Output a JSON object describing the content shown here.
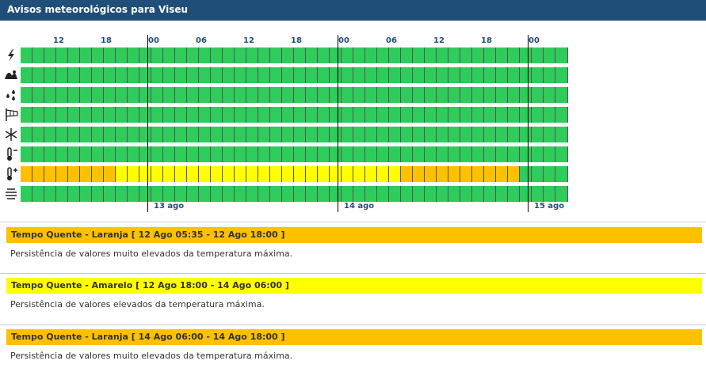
{
  "header": {
    "title": "Avisos meteorológicos para Viseu"
  },
  "timeline": {
    "hour_labels": [
      "12",
      "18",
      "00",
      "06",
      "12",
      "18",
      "00",
      "06",
      "12",
      "18",
      "00"
    ],
    "day_labels": [
      "13 ago",
      "14 ago",
      "15 ago"
    ],
    "slots_per_row": 46,
    "rows": [
      {
        "name": "lightning-icon",
        "levels": "gggggggggggggggggggggggggggggggggggggggggggggg"
      },
      {
        "name": "waves-icon",
        "levels": "gggggggggggggggggggggggggggggggggggggggggggggg"
      },
      {
        "name": "rain-icon",
        "levels": "gggggggggggggggggggggggggggggggggggggggggggggg"
      },
      {
        "name": "wind-flag-icon",
        "levels": "gggggggggggggggggggggggggggggggggggggggggggggg"
      },
      {
        "name": "snowflake-icon",
        "levels": "gggggggggggggggggggggggggggggggggggggggggggggg"
      },
      {
        "name": "thermometer-cold-icon",
        "levels": "gggggggggggggggggggggggggggggggggggggggggggggg"
      },
      {
        "name": "thermometer-hot-icon",
        "levels": "ooooooooyyyyyyyyyyyyyyyyyyyyyyyyoooooooooogggggg"
      },
      {
        "name": "fog-icon",
        "levels": "gggggggggggggggggggggggggggggggggggggggggggggg"
      }
    ]
  },
  "colors": {
    "green": "#2ecc5a",
    "yellow": "#ffff00",
    "orange": "#ffc000",
    "header": "#1f4e79"
  },
  "warnings": [
    {
      "title": "Tempo Quente - Laranja [ 12 Ago 05:35 - 12 Ago 18:00 ]",
      "description": "Persistência de valores muito elevados da temperatura máxima.",
      "level": "orange"
    },
    {
      "title": "Tempo Quente - Amarelo [ 12 Ago 18:00 - 14 Ago 06:00 ]",
      "description": "Persistência de valores elevados da temperatura máxima.",
      "level": "yellow"
    },
    {
      "title": "Tempo Quente - Laranja [ 14 Ago 06:00 - 14 Ago 18:00 ]",
      "description": "Persistência de valores muito elevados da temperatura máxima.",
      "level": "orange"
    }
  ]
}
